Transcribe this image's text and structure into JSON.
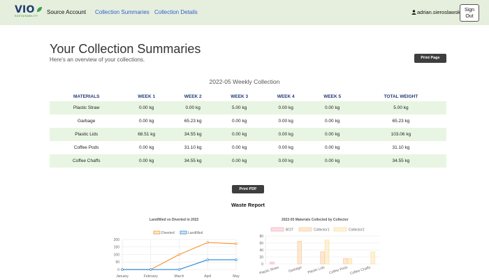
{
  "brand": {
    "name": "VIO",
    "tagline": "SUSTAINABILITY"
  },
  "nav": {
    "account": "Source Account",
    "summaries": "Collection Summaries",
    "details": "Collection Details",
    "user": "adrian.sieroslawski",
    "signout": "Sign Out"
  },
  "header": {
    "title": "Your Collection Summaries",
    "subtitle": "Here's an overview of your collections.",
    "print_page": "Print Page"
  },
  "summary": {
    "title": "2022-05 Weekly Collection",
    "columns": [
      "MATERIALS",
      "WEEK 1",
      "WEEK 2",
      "WEEK 3",
      "WEEK 4",
      "WEEK 5",
      "TOTAL WEIGHT"
    ],
    "rows": [
      [
        "Plastic Straw",
        "0.00 kg",
        "0.00 kg",
        "5.00 kg",
        "0.00 kg",
        "0.00 kg",
        "5.00 kg"
      ],
      [
        "Garbage",
        "0.00 kg",
        "65.23 kg",
        "0.00 kg",
        "0.00 kg",
        "0.00 kg",
        "65.23 kg"
      ],
      [
        "Plastic Lids",
        "68.51 kg",
        "34.55 kg",
        "0.00 kg",
        "0.00 kg",
        "0.00 kg",
        "103.06 kg"
      ],
      [
        "Coffee Pods",
        "0.00 kg",
        "31.10 kg",
        "0.00 kg",
        "0.00 kg",
        "0.00 kg",
        "31.10 kg"
      ],
      [
        "Coffee Chaffs",
        "0.00 kg",
        "34.55 kg",
        "0.00 kg",
        "0.00 kg",
        "0.00 kg",
        "34.55 kg"
      ]
    ]
  },
  "report": {
    "print_pdf": "Print PDF",
    "title": "Waste Report"
  },
  "colors": {
    "diverted": "#f39a3b",
    "landfilled": "#3b8fd9",
    "bcit": "#f7b3c2",
    "collector1": "#f9cf9f",
    "collector2": "#fbe3a8"
  },
  "chart_data": [
    {
      "type": "line",
      "title": "Landfilled vs Diverted in 2022",
      "categories": [
        "January",
        "February",
        "March",
        "April",
        "May"
      ],
      "series": [
        {
          "name": "Diverted",
          "values": [
            0,
            0,
            100,
            180,
            172
          ]
        },
        {
          "name": "Landfilled",
          "values": [
            0,
            0,
            0,
            65,
            65
          ]
        }
      ],
      "ylim": [
        0,
        200
      ],
      "yticks": [
        0,
        50,
        100,
        150,
        200
      ],
      "legend": "top"
    },
    {
      "type": "bar",
      "title": "2022-05 Materials Collected by Collector",
      "categories": [
        "Plastic Straw",
        "Garbage",
        "Plastic Lids",
        "Coffee Pods",
        "Coffee Chaffs"
      ],
      "series": [
        {
          "name": "BCIT",
          "values": [
            5,
            0,
            0,
            0,
            0
          ]
        },
        {
          "name": "Collector1",
          "values": [
            0,
            65.23,
            34.55,
            15.5,
            0
          ]
        },
        {
          "name": "Collector2",
          "values": [
            0,
            0,
            68.51,
            15.6,
            34.55
          ]
        }
      ],
      "ylim": [
        0,
        80
      ],
      "yticks": [
        0,
        20,
        40,
        60,
        80
      ],
      "legend": "top"
    }
  ]
}
